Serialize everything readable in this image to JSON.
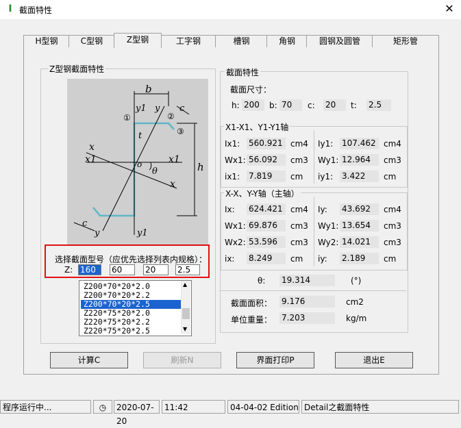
{
  "window": {
    "title": "截面特性",
    "close": "✕"
  },
  "tabs": [
    "H型钢",
    "C型钢",
    "Z型钢",
    "工字钢",
    "槽钢",
    "角钢",
    "圆钢及圆管",
    "矩形管"
  ],
  "left_group": {
    "title": "Z型钢截面特性",
    "figure_labels": {
      "b": "b",
      "c_top": "c",
      "y1": "y1",
      "y": "y",
      "t": "t",
      "x": "x",
      "x1": "x1",
      "o": "o",
      "theta": "θ",
      "h": "h",
      "c_bot": "c",
      "n1": "①",
      "n2": "②",
      "n3": "③"
    },
    "select_label": "选择截面型号（应优先选择列表内规格）：",
    "z_label": "Z:",
    "z_inputs": [
      "160",
      "60",
      "20",
      "2.5"
    ],
    "list": [
      "Z200*70*20*2.0",
      "Z200*70*20*2.2",
      "Z200*70*20*2.5",
      "Z220*75*20*2.0",
      "Z220*75*20*2.2",
      "Z220*75*20*2.5"
    ],
    "list_selected": 2
  },
  "right_group": {
    "title": "截面特性",
    "dims_label": "截面尺寸：",
    "dims": [
      {
        "label": "h:",
        "value": "200"
      },
      {
        "label": "b:",
        "value": "70"
      },
      {
        "label": "c:",
        "value": "20"
      },
      {
        "label": "t:",
        "value": "2.5"
      }
    ],
    "axis1_title": "X1-X1、Y1-Y1轴",
    "axis1": [
      {
        "l_label": "Ix1:",
        "l_val": "560.921",
        "l_unit": "cm4",
        "r_label": "Iy1:",
        "r_val": "107.462",
        "r_unit": "cm4"
      },
      {
        "l_label": "Wx1:",
        "l_val": "56.092",
        "l_unit": "cm3",
        "r_label": "Wy1:",
        "r_val": "12.964",
        "r_unit": "cm3"
      },
      {
        "l_label": "ix1:",
        "l_val": "7.819",
        "l_unit": "cm",
        "r_label": "iy1:",
        "r_val": "3.422",
        "r_unit": "cm"
      }
    ],
    "axis2_title": "X-X、Y-Y轴（主轴）",
    "axis2": [
      {
        "l_label": "Ix:",
        "l_val": "624.421",
        "l_unit": "cm4",
        "r_label": "Iy:",
        "r_val": "43.692",
        "r_unit": "cm4"
      },
      {
        "l_label": "Wx1:",
        "l_val": "69.876",
        "l_unit": "cm3",
        "r_label": "Wy1:",
        "r_val": "13.654",
        "r_unit": "cm3"
      },
      {
        "l_label": "Wx2:",
        "l_val": "53.596",
        "l_unit": "cm3",
        "r_label": "Wy2:",
        "r_val": "14.021",
        "r_unit": "cm3"
      },
      {
        "l_label": "ix:",
        "l_val": "8.249",
        "l_unit": "cm",
        "r_label": "iy:",
        "r_val": "2.189",
        "r_unit": "cm"
      }
    ],
    "theta": {
      "label": "θ:",
      "value": "19.314",
      "unit": "(°)"
    },
    "area": {
      "label": "截面面积：",
      "value": "9.176",
      "unit": "cm2"
    },
    "weight": {
      "label": "单位重量：",
      "value": "7.203",
      "unit": "kg/m"
    }
  },
  "buttons": {
    "calc": "计算C",
    "refresh": "刷新N",
    "print": "界面打印P",
    "exit": "退出E"
  },
  "status": {
    "running": "程序运行中...",
    "date": "2020-07-20",
    "time": "11:42",
    "edition": "04-04-02 Edition",
    "detail": "Detail之截面特性"
  }
}
